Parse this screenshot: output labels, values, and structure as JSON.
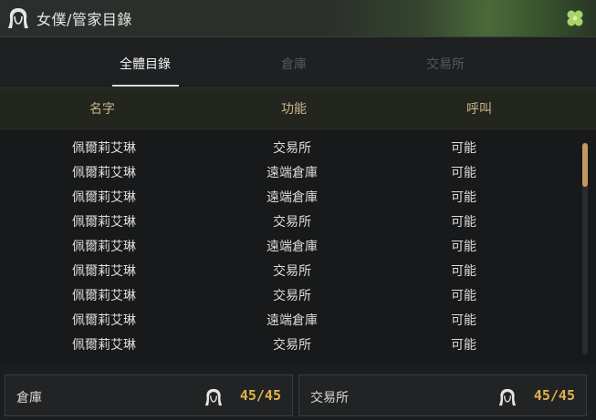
{
  "window": {
    "title": "女僕/管家目錄"
  },
  "tabs": [
    {
      "label": "全體目錄",
      "active": true
    },
    {
      "label": "倉庫",
      "active": false
    },
    {
      "label": "交易所",
      "active": false
    }
  ],
  "columns": {
    "name": "名字",
    "function": "功能",
    "call": "呼叫"
  },
  "rows": [
    {
      "name": "佩爾莉艾琳",
      "function": "交易所",
      "call": "可能"
    },
    {
      "name": "佩爾莉艾琳",
      "function": "遠端倉庫",
      "call": "可能"
    },
    {
      "name": "佩爾莉艾琳",
      "function": "遠端倉庫",
      "call": "可能"
    },
    {
      "name": "佩爾莉艾琳",
      "function": "交易所",
      "call": "可能"
    },
    {
      "name": "佩爾莉艾琳",
      "function": "遠端倉庫",
      "call": "可能"
    },
    {
      "name": "佩爾莉艾琳",
      "function": "交易所",
      "call": "可能"
    },
    {
      "name": "佩爾莉艾琳",
      "function": "交易所",
      "call": "可能"
    },
    {
      "name": "佩爾莉艾琳",
      "function": "遠端倉庫",
      "call": "可能"
    },
    {
      "name": "佩爾莉艾琳",
      "function": "交易所",
      "call": "可能"
    }
  ],
  "footer": {
    "warehouse": {
      "label": "倉庫",
      "count": "45/45",
      "icon": "maid-icon"
    },
    "market": {
      "label": "交易所",
      "count": "45/45",
      "icon": "maid-icon"
    }
  },
  "colors": {
    "accent_gold": "#dfb24a",
    "header_text": "#cdb58a",
    "scroll_thumb": "#c39a5e"
  }
}
